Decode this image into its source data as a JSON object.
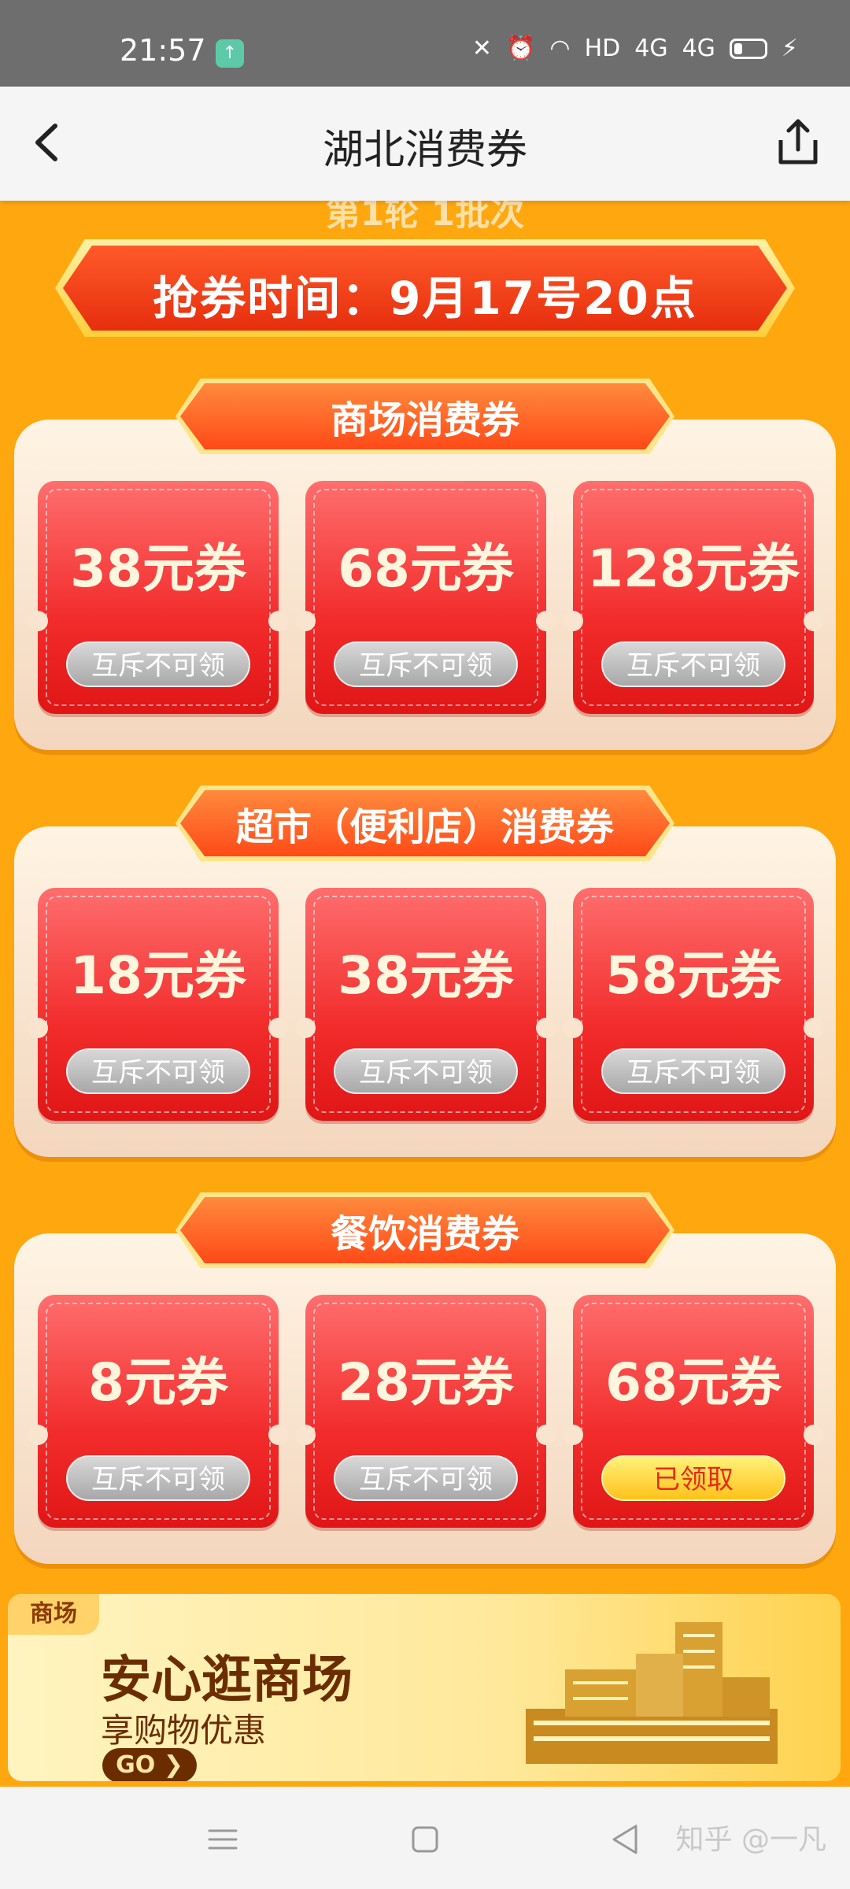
{
  "status_bar": {
    "time": "21:57",
    "network": "HD",
    "signal1": "4G",
    "signal2": "4G"
  },
  "nav": {
    "title": "湖北消费券"
  },
  "round_text": "第1轮 1批次",
  "grab_time": "抢券时间：9月17号20点",
  "sections": [
    {
      "title": "商场消费券",
      "coupons": [
        {
          "amount": "38元券",
          "button": "互斥不可领",
          "claimed": false
        },
        {
          "amount": "68元券",
          "button": "互斥不可领",
          "claimed": false
        },
        {
          "amount": "128元券",
          "button": "互斥不可领",
          "claimed": false
        }
      ]
    },
    {
      "title": "超市（便利店）消费券",
      "coupons": [
        {
          "amount": "18元券",
          "button": "互斥不可领",
          "claimed": false
        },
        {
          "amount": "38元券",
          "button": "互斥不可领",
          "claimed": false
        },
        {
          "amount": "58元券",
          "button": "互斥不可领",
          "claimed": false
        }
      ]
    },
    {
      "title": "餐饮消费券",
      "coupons": [
        {
          "amount": "8元券",
          "button": "互斥不可领",
          "claimed": false
        },
        {
          "amount": "28元券",
          "button": "互斥不可领",
          "claimed": false
        },
        {
          "amount": "68元券",
          "button": "已领取",
          "claimed": true
        }
      ]
    }
  ],
  "ad": {
    "tag": "商场",
    "headline": "安心逛商场",
    "subtitle": "享购物优惠",
    "go": "GO ❯"
  },
  "watermark": "知乎 @一凡",
  "colors": {
    "page_bg": "#ffa70f",
    "coupon_red": "#f22b2b",
    "disabled_grey": "#b5b5b5",
    "claimed_yellow": "#ffd93a"
  }
}
